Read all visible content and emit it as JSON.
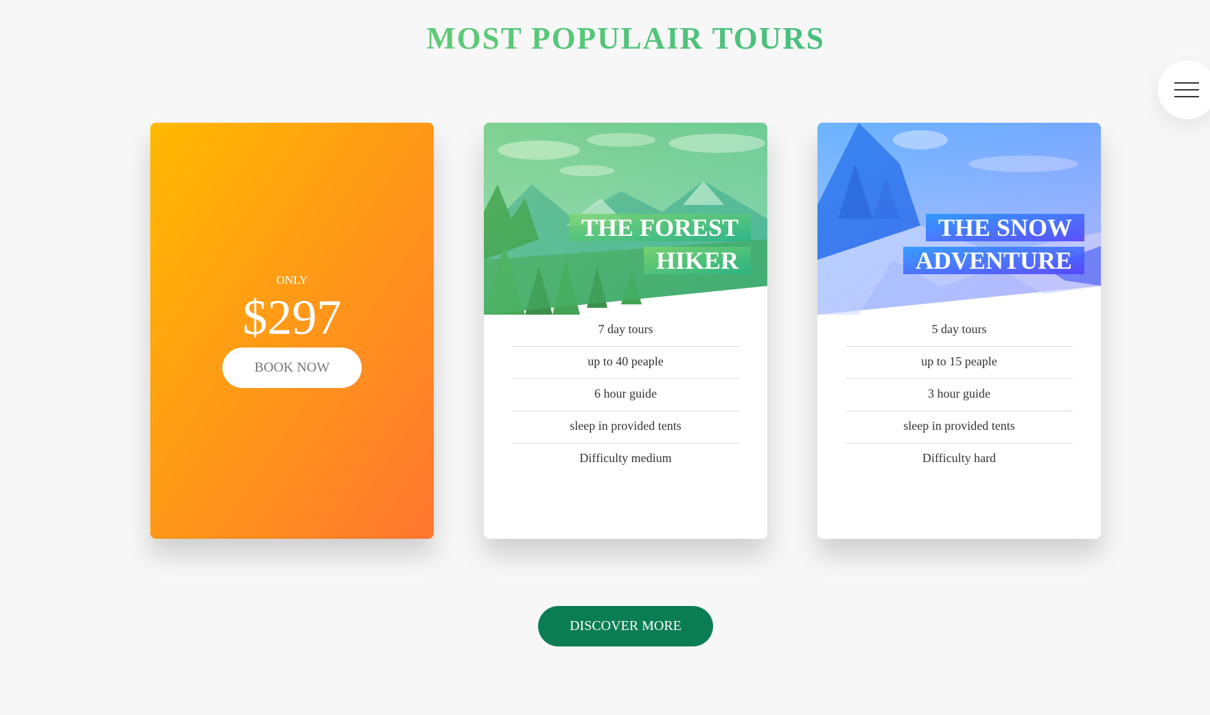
{
  "section": {
    "title": "MOST POPULAIR TOURS"
  },
  "navigation": {
    "icon": "hamburger-menu-icon"
  },
  "price_card": {
    "only_label": "ONLY",
    "price": "$297",
    "button_label": "BOOK NOW"
  },
  "tours": [
    {
      "heading_line1": "THE FOREST",
      "heading_line2": "HIKER",
      "details": [
        "7 day tours",
        "up to 40 peaple",
        "6 hour guide",
        "sleep in provided tents",
        "Difficulty medium"
      ]
    },
    {
      "heading_line1": "THE SNOW",
      "heading_line2": "ADVENTURE",
      "details": [
        "5 day tours",
        "up to 15 peaple",
        "3 hour guide",
        "sleep in provided tents",
        "Difficulty hard"
      ]
    }
  ],
  "discover_button": {
    "label": "DISCOVER MORE"
  },
  "colors": {
    "primary_light": "#7ed56f",
    "primary_dark": "#28b485",
    "secondary_light": "#ffb900",
    "secondary_dark": "#ff7730",
    "tertiary_light": "#2998ff",
    "tertiary_dark": "#5643fa",
    "button_green": "#0b7d54"
  }
}
